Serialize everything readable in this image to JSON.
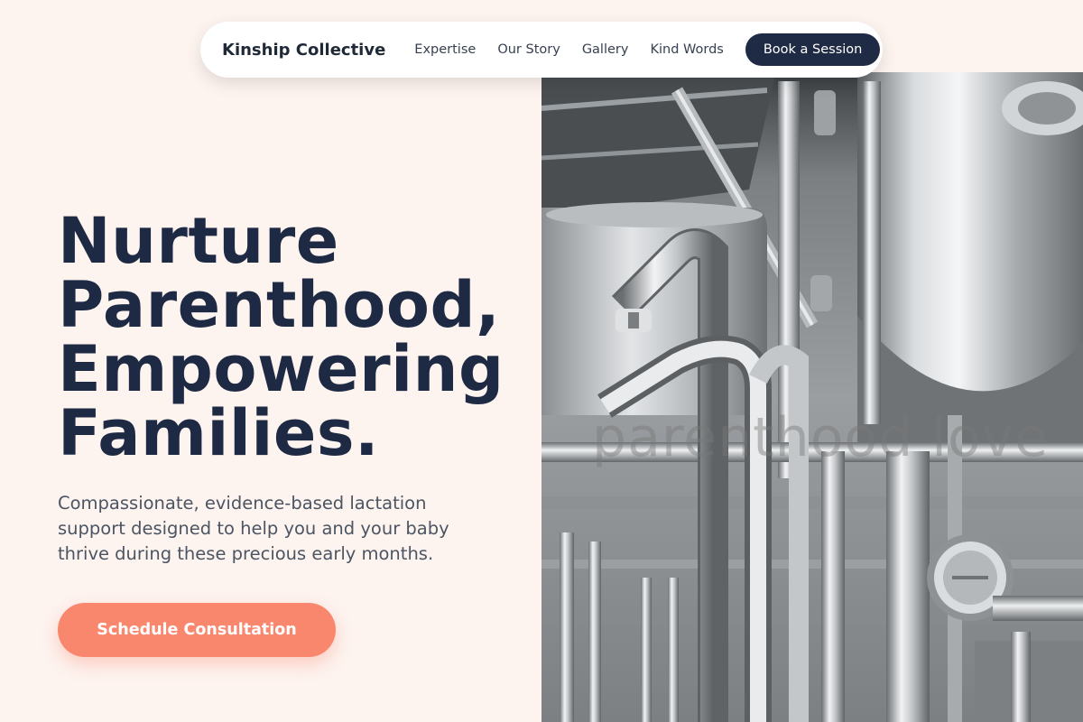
{
  "nav": {
    "brand": "Kinship Collective",
    "links": [
      "Expertise",
      "Our Story",
      "Gallery",
      "Kind Words"
    ],
    "cta": "Book a Session"
  },
  "hero": {
    "title_lines": [
      "Nurture",
      "Parenthood,",
      "Empowering",
      "Families."
    ],
    "subtitle": "Compassionate, evidence-based lactation support designed to help you and your baby thrive during these precious early months.",
    "cta": "Schedule Consultation"
  },
  "image": {
    "watermark": "parenthood love"
  },
  "colors": {
    "background": "#fdf3ef",
    "heading": "#1e2a44",
    "nav_button": "#1f2a44",
    "accent": "#f9876e"
  }
}
